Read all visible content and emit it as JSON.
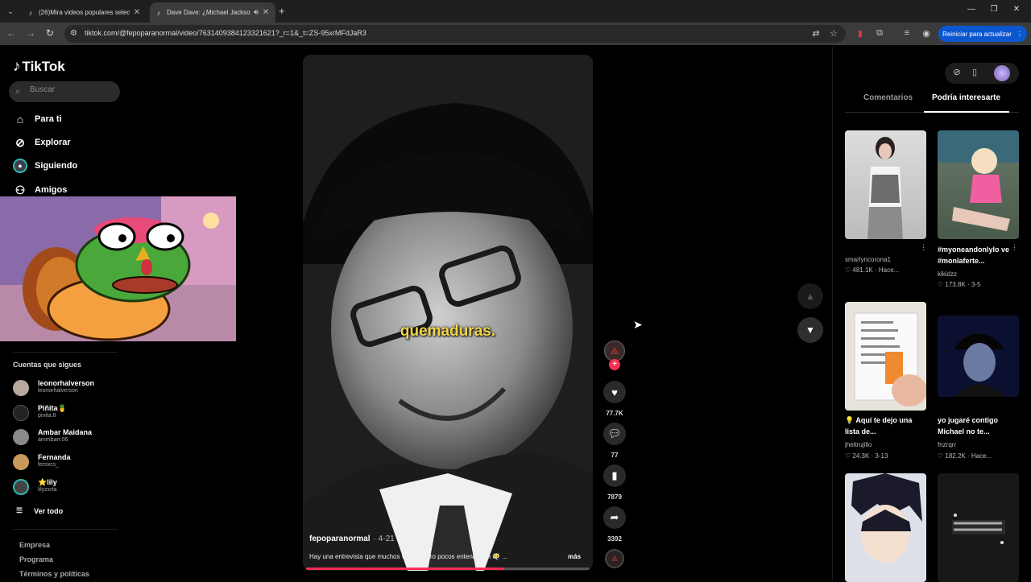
{
  "browser": {
    "tabs": [
      {
        "title": "(26)Mira videos populares selec",
        "icon": "tiktok-icon",
        "close": "✕"
      },
      {
        "title": "Dave Dave: ¿Michael Jackso",
        "icon": "tiktok-icon",
        "close": "✕",
        "audio_icon": "speaker-icon"
      }
    ],
    "url": "tiktok.com/@fepoparanormal/video/7631409384123321621?_r=1&_t=ZS-95xrMFdJaR3",
    "update_button": "Reiniciar para actualizar"
  },
  "sidebar": {
    "logo": "TikTok",
    "search_placeholder": "Buscar",
    "nav": [
      {
        "label": "Para ti",
        "icon": "home-icon"
      },
      {
        "label": "Explorar",
        "icon": "compass-icon"
      },
      {
        "label": "Siguiendo",
        "icon": "following-avatar-icon"
      },
      {
        "label": "Amigos",
        "icon": "friends-icon"
      }
    ],
    "following_title": "Cuentas que sigues",
    "accounts": [
      {
        "name": "leonorhalverson",
        "handle": "leonorhalverson"
      },
      {
        "name": "Piñita🍍",
        "handle": "pinita.8"
      },
      {
        "name": "Ambar Maidana",
        "handle": "ammbarr.06"
      },
      {
        "name": "Fernanda",
        "handle": "fersxcs_"
      },
      {
        "name": "⭐lily",
        "handle": "lilyzxrta"
      }
    ],
    "see_all": "Ver todo",
    "footer": [
      "Empresa",
      "Programa",
      "Términos y políticas"
    ]
  },
  "video": {
    "caption_word": "quemaduras.",
    "author": "fepoparanormal",
    "date": "· 4-21",
    "description": "Hay una entrevista que muchos vieron, pero pocos entendieron 😶‍🌫️ ...",
    "more": "más",
    "progress": 0.7
  },
  "actions": {
    "likes": "77.7K",
    "comments": "77",
    "saves": "7879",
    "shares": "3392"
  },
  "right_panel": {
    "tabs": [
      "Comentarios",
      "Podría interesarte"
    ],
    "active_tab": "Podría interesarte",
    "cards": [
      {
        "title": "",
        "user": "smarlyncorona1",
        "stats": "♡ 481.1K · Hace..."
      },
      {
        "title": "#myoneandonlylo ve #monlaferte...",
        "user": "kikidzz",
        "stats": "♡ 173.8K · 3-5"
      },
      {
        "title": "💡 Aquí te dejo una lista de...",
        "user": "jheitrujillo",
        "stats": "♡ 24.3K · 3-13"
      },
      {
        "title": "yo jugaré contigo Michael no te...",
        "user": "fnzrqrr",
        "stats": "♡ 182.2K · Hace..."
      }
    ]
  },
  "colors": {
    "accent": "#fe2c55",
    "caption": "#f2d64a",
    "update_button": "#0b57d0"
  }
}
